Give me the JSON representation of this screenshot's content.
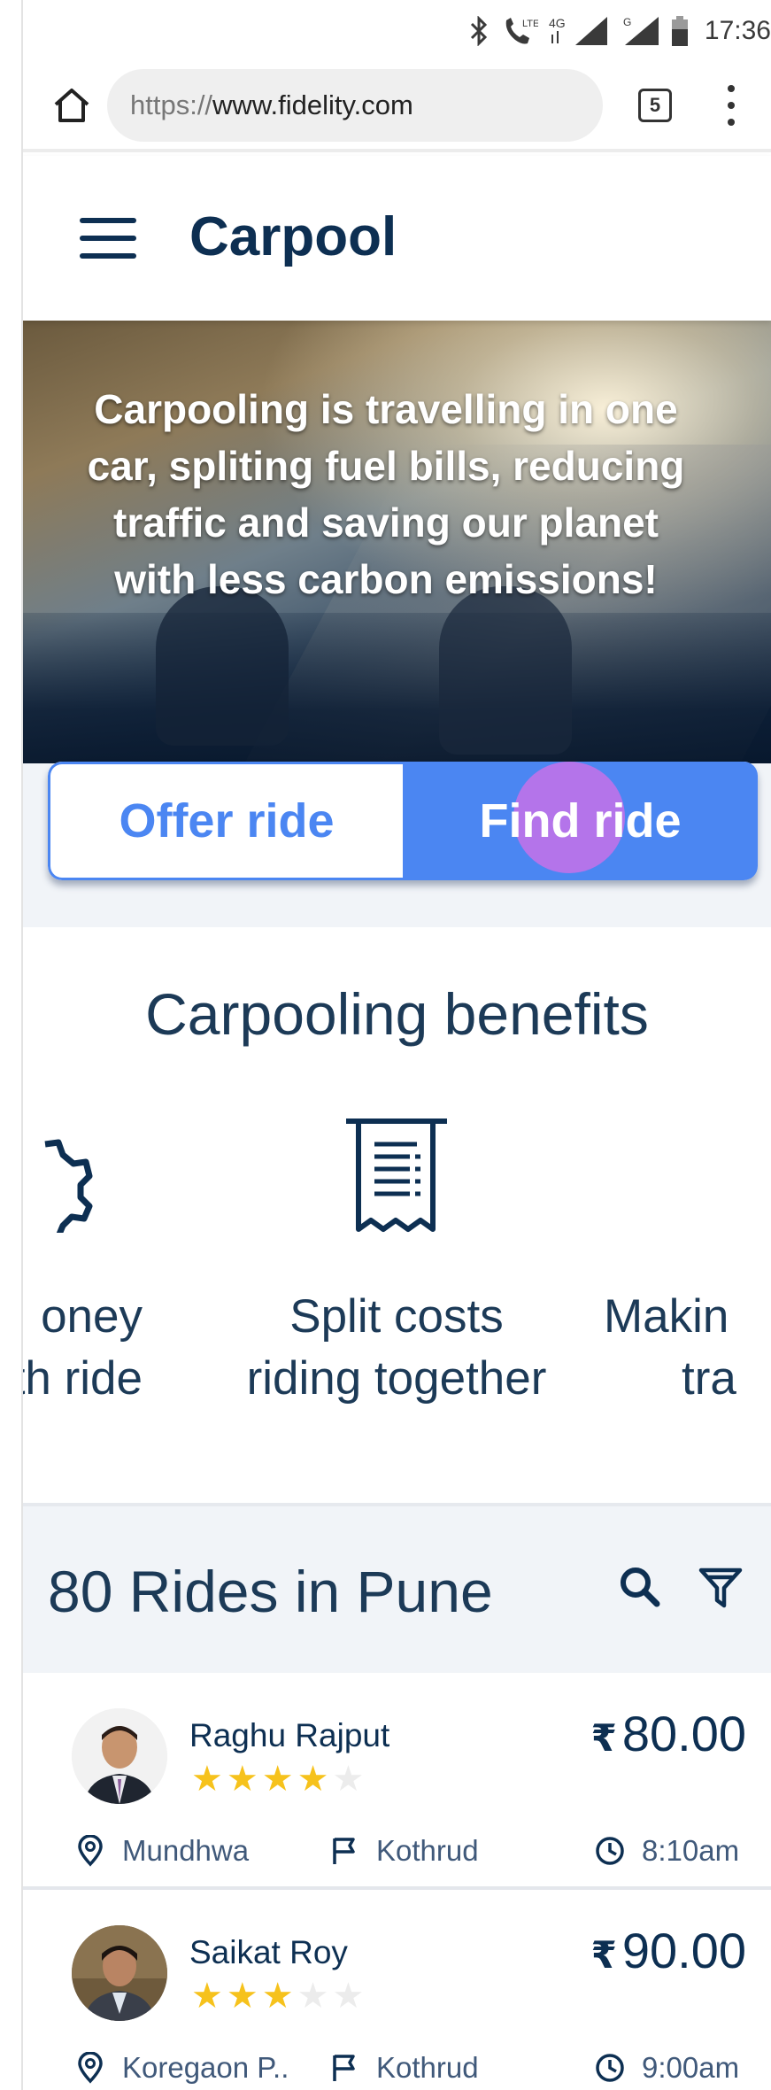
{
  "status_bar": {
    "time": "17:36",
    "network_label": "4G",
    "lte_label": "LTE",
    "icons": [
      "bluetooth-icon",
      "call-lte-icon",
      "signal-4g-icon",
      "signal-g-icon",
      "battery-icon"
    ]
  },
  "browser": {
    "url_scheme": "https://",
    "url_host": "www.fidelity.com",
    "tab_count": "5",
    "icons": [
      "home-icon",
      "tabs-icon",
      "more-vert-icon"
    ]
  },
  "app": {
    "title": "Carpool",
    "menu_icon": "hamburger-icon"
  },
  "hero": {
    "text": "Carpooling is travelling in one car, spliting fuel bills, reducing traffic and saving our planet with less carbon emissions!"
  },
  "toggle": {
    "offer_label": "Offer ride",
    "find_label": "Find ride",
    "selected": "Find ride",
    "accent_color": "#4b86f2"
  },
  "benefits": {
    "title": "Carpooling benefits",
    "items": [
      {
        "icon": "gear-icon",
        "line1": "oney",
        "line2": "th ride"
      },
      {
        "icon": "receipt-icon",
        "line1": "Split costs",
        "line2": "riding together"
      },
      {
        "icon": "person-icon",
        "line1": "Makin",
        "line2": "tra"
      }
    ]
  },
  "rides": {
    "title": "80 Rides in Pune",
    "search_icon": "search-icon",
    "filter_icon": "filter-icon",
    "items": [
      {
        "driver": "Raghu Rajput",
        "rating": 4,
        "rating_max": 5,
        "currency": "₹",
        "price": "80.00",
        "from": "Mundhwa",
        "to": "Kothrud",
        "time": "8:10am"
      },
      {
        "driver": "Saikat Roy",
        "rating": 3,
        "rating_max": 5,
        "currency": "₹",
        "price": "90.00",
        "from": "Koregaon P..",
        "to": "Kothrud",
        "time": "9:00am"
      }
    ]
  }
}
